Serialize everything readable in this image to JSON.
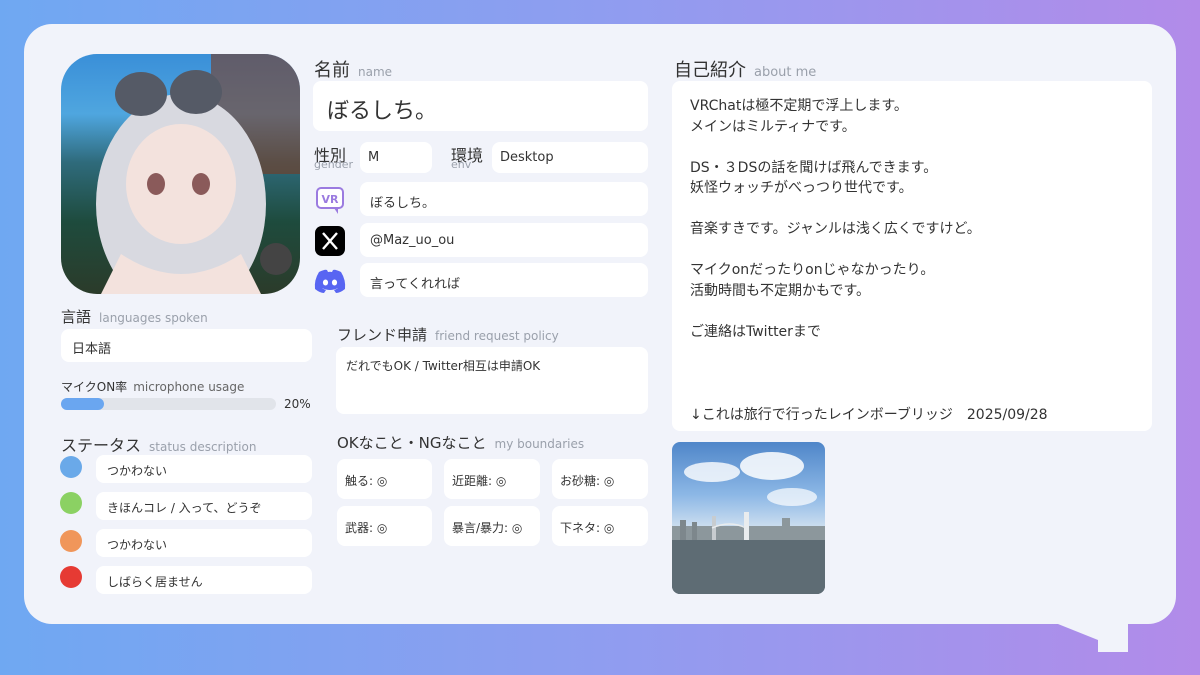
{
  "profile": {
    "name_label": "名前",
    "name_sub": "name",
    "name": "ぼるしち。",
    "gender_label": "性別",
    "gender_sub": "gender",
    "gender": "M",
    "env_label": "環境",
    "env_sub": "env",
    "env": "Desktop",
    "vrchat_name": "ぼるしち。",
    "twitter": "@Maz_uo_ou",
    "discord": "言ってくれれば"
  },
  "languages": {
    "label": "言語",
    "sub": "languages spoken",
    "value": "日本語"
  },
  "mic": {
    "label": "マイクON率",
    "sub": "microphone usage",
    "percent_text": "20%",
    "percent": 20
  },
  "status": {
    "label": "ステータス",
    "sub": "status description",
    "items": [
      {
        "color": "#6aa9e9",
        "text": "つかわない"
      },
      {
        "color": "#8bd163",
        "text": "きほんコレ / 入って、どうぞ"
      },
      {
        "color": "#f0965a",
        "text": "つかわない"
      },
      {
        "color": "#e63a33",
        "text": "しばらく居ません"
      }
    ]
  },
  "friend": {
    "label": "フレンド申請",
    "sub": "friend request policy",
    "value": "だれでもOK / Twitter相互は申請OK"
  },
  "boundaries": {
    "label": "OKなこと・NGなこと",
    "sub": "my boundaries",
    "items": [
      "触る: ◎",
      "近距離: ◎",
      "お砂糖: ◎",
      "武器: ◎",
      "暴言/暴力: ◎",
      "下ネタ: ◎"
    ]
  },
  "about": {
    "label": "自己紹介",
    "sub": "about me",
    "lines": [
      "VRChatは極不定期で浮上します。",
      "メインはミルティナです。",
      "",
      "DS・３DSの話を聞けば飛んできます。",
      "妖怪ウォッチがべっつり世代です。",
      "",
      "音楽すきです。ジャンルは浅く広くですけど。",
      "",
      "マイクonだったりonじゃなかったり。",
      "活動時間も不定期かもです。",
      "",
      "ご連絡はTwitterまで"
    ],
    "caption": "↓これは旅行で行ったレインボーブリッジ　2025/09/28"
  },
  "icons": {
    "vrchat": "vrchat-icon",
    "x": "x-icon",
    "discord": "discord-icon"
  },
  "vr_badge": "VR"
}
